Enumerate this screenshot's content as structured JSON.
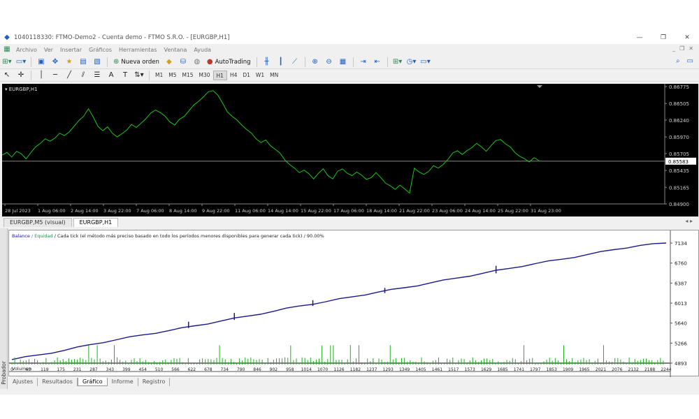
{
  "window": {
    "title": "1040118330: FTMO-Demo2 - Cuenta demo - FTMO S.R.O. - [EURGBP,H1]",
    "minimize": "—",
    "restore": "❐",
    "close": "✕"
  },
  "menu": {
    "items": [
      "Archivo",
      "Ver",
      "Insertar",
      "Gráficos",
      "Herramientas",
      "Ventana",
      "Ayuda"
    ],
    "mdi": [
      "_",
      "❐",
      "✕"
    ]
  },
  "toolbar": {
    "new_order": "Nueva orden",
    "autotrading": "AutoTrading",
    "timeframes": [
      "M1",
      "M5",
      "M15",
      "M30",
      "H1",
      "H4",
      "D1",
      "W1",
      "MN"
    ],
    "active_timeframe": "H1"
  },
  "chart": {
    "label": "EURGBP,H1",
    "current_price": "0.85583",
    "price_ticks": [
      "0.86775",
      "0.86505",
      "0.86240",
      "0.85970",
      "0.85705",
      "0.85435",
      "0.85165",
      "0.84900"
    ],
    "price_min": 0.849,
    "price_max": 0.86775,
    "time_labels": [
      "28 Jul 2023",
      "1 Aug 06:00",
      "2 Aug 14:00",
      "3 Aug 22:00",
      "7 Aug 06:00",
      "8 Aug 14:00",
      "9 Aug 22:00",
      "11 Aug 06:00",
      "14 Aug 14:00",
      "15 Aug 22:00",
      "17 Aug 06:00",
      "18 Aug 14:00",
      "21 Aug 22:00",
      "23 Aug 06:00",
      "24 Aug 14:00",
      "25 Aug 22:00",
      "31 Aug 23:00"
    ],
    "line_color": "#18c418",
    "series": [
      0.8568,
      0.8571,
      0.8566,
      0.8574,
      0.8569,
      0.8563,
      0.8572,
      0.858,
      0.8588,
      0.8594,
      0.8589,
      0.8596,
      0.8603,
      0.8598,
      0.8606,
      0.8614,
      0.8622,
      0.8631,
      0.8642,
      0.8628,
      0.8615,
      0.8607,
      0.8612,
      0.8604,
      0.8597,
      0.8601,
      0.8609,
      0.8617,
      0.8611,
      0.862,
      0.8626,
      0.8634,
      0.8641,
      0.8636,
      0.8629,
      0.8622,
      0.8616,
      0.8624,
      0.8631,
      0.8639,
      0.8647,
      0.8655,
      0.8661,
      0.8668,
      0.8672,
      0.8664,
      0.865,
      0.8638,
      0.863,
      0.8623,
      0.8617,
      0.8609,
      0.8602,
      0.8595,
      0.8588,
      0.8591,
      0.8584,
      0.8577,
      0.857,
      0.8561,
      0.8553,
      0.8546,
      0.8541,
      0.8544,
      0.8537,
      0.8531,
      0.8539,
      0.8545,
      0.8536,
      0.853,
      0.8541,
      0.8547,
      0.8539,
      0.8534,
      0.8542,
      0.8536,
      0.8528,
      0.8533,
      0.854,
      0.8531,
      0.8524,
      0.8519,
      0.8512,
      0.8521,
      0.8514,
      0.8506,
      0.8548,
      0.8541,
      0.8536,
      0.8543,
      0.8551,
      0.8546,
      0.8554,
      0.8561,
      0.857,
      0.8576,
      0.8569,
      0.8574,
      0.8581,
      0.8587,
      0.858,
      0.8575,
      0.8583,
      0.859,
      0.8594,
      0.8586,
      0.858,
      0.8573,
      0.8566,
      0.8561,
      0.8558,
      0.8564,
      0.8558
    ]
  },
  "chart_tabs": [
    "EURGBP,M5 (visual)",
    "EURGBP,H1"
  ],
  "chart_tabs_active": 1,
  "chart_tabs_nav": "◂ ▸",
  "tester": {
    "header_balance": "Balance",
    "header_equity": "Equidad",
    "header_model": "Cada tick (el método más preciso basado en todo los períodos menores disponibles para generar cada tick)",
    "header_quality": "90.00%",
    "balance_ticks": [
      "7134",
      "6760",
      "6387",
      "6013",
      "5640",
      "5266",
      "4893"
    ],
    "balance_min": 4893,
    "balance_max": 7134,
    "balance_color": "#1a1a8c",
    "balance_series": [
      4960,
      5045,
      5130,
      5240,
      5330,
      5420,
      5500,
      5590,
      5680,
      5770,
      5860,
      5960,
      6040,
      6130,
      6220,
      6300,
      6390,
      6480,
      6570,
      6660,
      6750,
      6830,
      6920,
      7010,
      7090,
      7134
    ],
    "volume_label": "Volumen",
    "volume_color": "#20b020",
    "x_labels": [
      "0",
      "63",
      "119",
      "175",
      "231",
      "287",
      "343",
      "399",
      "454",
      "510",
      "566",
      "622",
      "678",
      "734",
      "790",
      "846",
      "902",
      "958",
      "1014",
      "1070",
      "1126",
      "1182",
      "1237",
      "1293",
      "1349",
      "1405",
      "1461",
      "1517",
      "1573",
      "1629",
      "1685",
      "1741",
      "1797",
      "1853",
      "1909",
      "1965",
      "2021",
      "2076",
      "2132",
      "2188",
      "2244"
    ]
  },
  "side_label": "Probador",
  "bottom_tabs": [
    "Ajustes",
    "Resultados",
    "Gráfico",
    "Informe",
    "Registro"
  ],
  "bottom_tabs_active": 2
}
